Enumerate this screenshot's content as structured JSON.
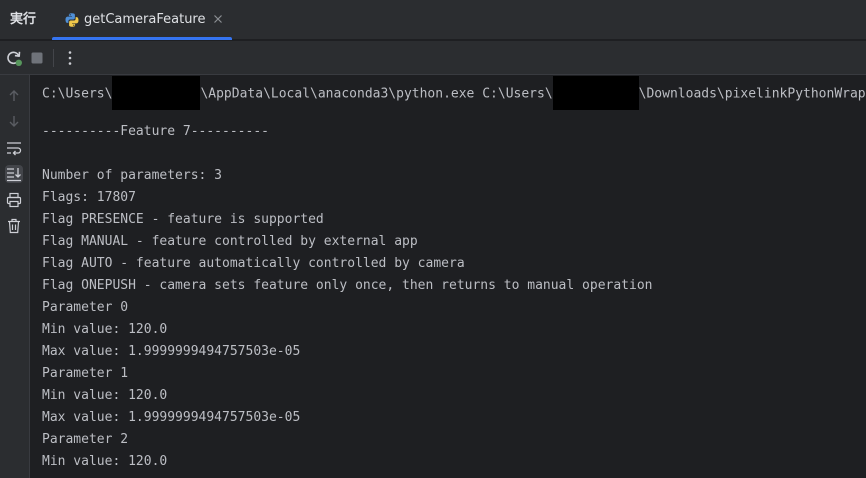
{
  "tool_window": {
    "title": "実行",
    "tab": {
      "label": "getCameraFeature",
      "icon": "python-icon"
    }
  },
  "toolbar": {
    "buttons": [
      {
        "name": "rerun-icon"
      },
      {
        "name": "stop-icon"
      },
      {
        "name": "more-options-icon"
      }
    ]
  },
  "gutter": {
    "buttons": [
      {
        "name": "up-arrow-icon"
      },
      {
        "name": "down-arrow-icon"
      },
      {
        "name": "soft-wrap-icon"
      },
      {
        "name": "scroll-to-end-icon"
      },
      {
        "name": "print-icon"
      },
      {
        "name": "trash-icon"
      }
    ]
  },
  "console": {
    "command": {
      "part1": "C:\\Users\\",
      "part2": "\\AppData\\Local\\anaconda3\\python.exe C:\\Users\\",
      "part3": "\\Downloads\\pixelinkPythonWrap"
    },
    "lines": [
      "",
      "----------Feature 7----------",
      "",
      "Number of parameters: 3",
      "Flags: 17807",
      "Flag PRESENCE - feature is supported",
      "Flag MANUAL - feature controlled by external app",
      "Flag AUTO - feature automatically controlled by camera",
      "Flag ONEPUSH - camera sets feature only once, then returns to manual operation",
      "Parameter 0",
      "Min value: 120.0",
      "Max value: 1.9999999494757503e-05",
      "Parameter 1",
      "Min value: 120.0",
      "Max value: 1.9999999494757503e-05",
      "Parameter 2",
      "Min value: 120.0"
    ]
  },
  "colors": {
    "accent": "#3574f0",
    "background": "#1e1f22",
    "panel": "#2b2d30",
    "text": "#bcbec4"
  }
}
